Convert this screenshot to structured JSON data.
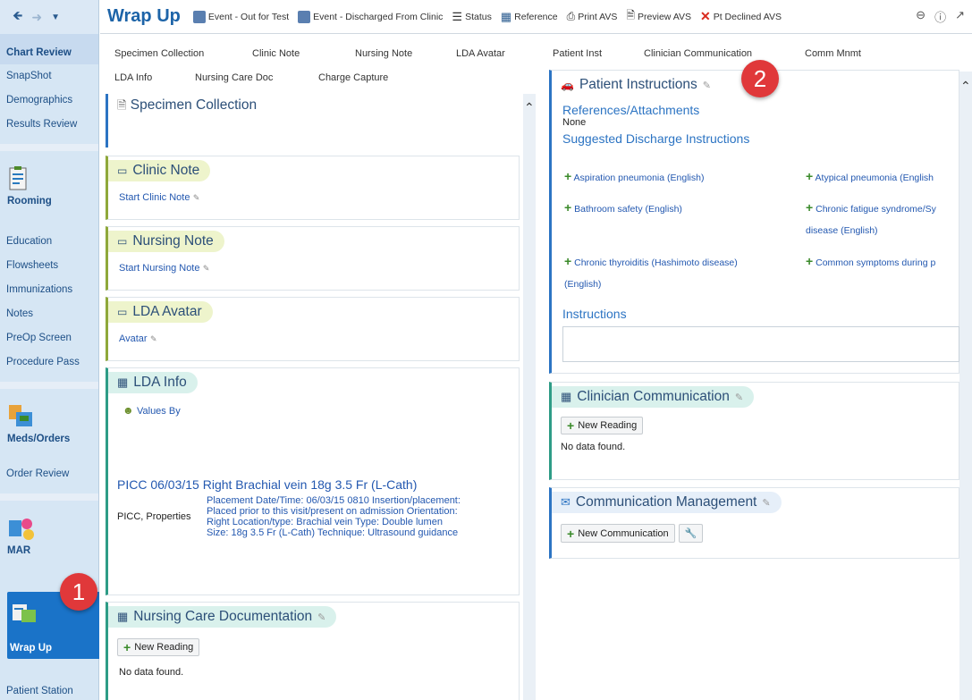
{
  "app": {
    "title": "Wrap Up"
  },
  "rail": {
    "items_top": [
      "Chart Review",
      "SnapShot",
      "Demographics",
      "Results Review"
    ],
    "rooming": "Rooming",
    "items_mid": [
      "Education",
      "Flowsheets",
      "Immunizations",
      "Notes",
      "PreOp Screen",
      "Procedure Pass"
    ],
    "medsorders": "Meds/Orders",
    "order_review": "Order Review",
    "mar": "MAR",
    "wrapup": "Wrap Up",
    "patient_station": "Patient Station"
  },
  "toolbar": {
    "e1": "Event - Out for Test",
    "e2": "Event - Discharged From Clinic",
    "status": "Status",
    "reference": "Reference",
    "print": "Print AVS",
    "preview": "Preview AVS",
    "declined": "Pt Declined AVS"
  },
  "tabs": {
    "row1": [
      "Specimen Collection",
      "Clinic Note",
      "Nursing Note",
      "LDA Avatar"
    ],
    "row2": [
      "LDA Info",
      "Nursing Care Doc",
      "Charge Capture"
    ],
    "right": [
      "Patient Inst",
      "Clinician Communication",
      "Comm Mnmt"
    ]
  },
  "sections": {
    "specimen": "Specimen Collection",
    "clinic": {
      "title": "Clinic Note",
      "link": "Start Clinic Note"
    },
    "nursing": {
      "title": "Nursing Note",
      "link": "Start Nursing Note"
    },
    "lda_avatar": {
      "title": "LDA Avatar",
      "link": "Avatar"
    },
    "lda_info": {
      "title": "LDA Info",
      "values_by": "Values By",
      "picc_title": "PICC 06/03/15 Right Brachial vein 18g 3.5 Fr (L-Cath)",
      "picc_label": "PICC, Properties",
      "picc_detail": "Placement Date/Time: 06/03/15 0810 Insertion/placement: Placed prior to this visit/present on admission Orientation: Right Location/type: Brachial vein Type: Double lumen Size: 18g 3.5 Fr (L-Cath) Technique: Ultrasound guidance"
    },
    "nursing_care": {
      "title": "Nursing Care Documentation",
      "button": "New Reading",
      "empty": "No data found."
    },
    "patient_inst": {
      "title": "Patient Instructions",
      "refs": "References/Attachments",
      "none": "None",
      "suggested": "Suggested Discharge Instructions",
      "items": [
        "Aspiration pneumonia (English)",
        "Atypical pneumonia (English",
        "Bathroom safety (English)",
        "Chronic fatigue syndrome/Sy",
        "disease (English)",
        "Chronic thyroiditis (Hashimoto disease)",
        "(English)",
        "Common symptoms during p"
      ],
      "instructions": "Instructions"
    },
    "clinician": {
      "title": "Clinician Communication",
      "button": "New Reading",
      "empty": "No data found."
    },
    "comm_mgmt": {
      "title": "Communication Management",
      "button": "New Communication"
    }
  },
  "badges": {
    "one": "1",
    "two": "2"
  }
}
